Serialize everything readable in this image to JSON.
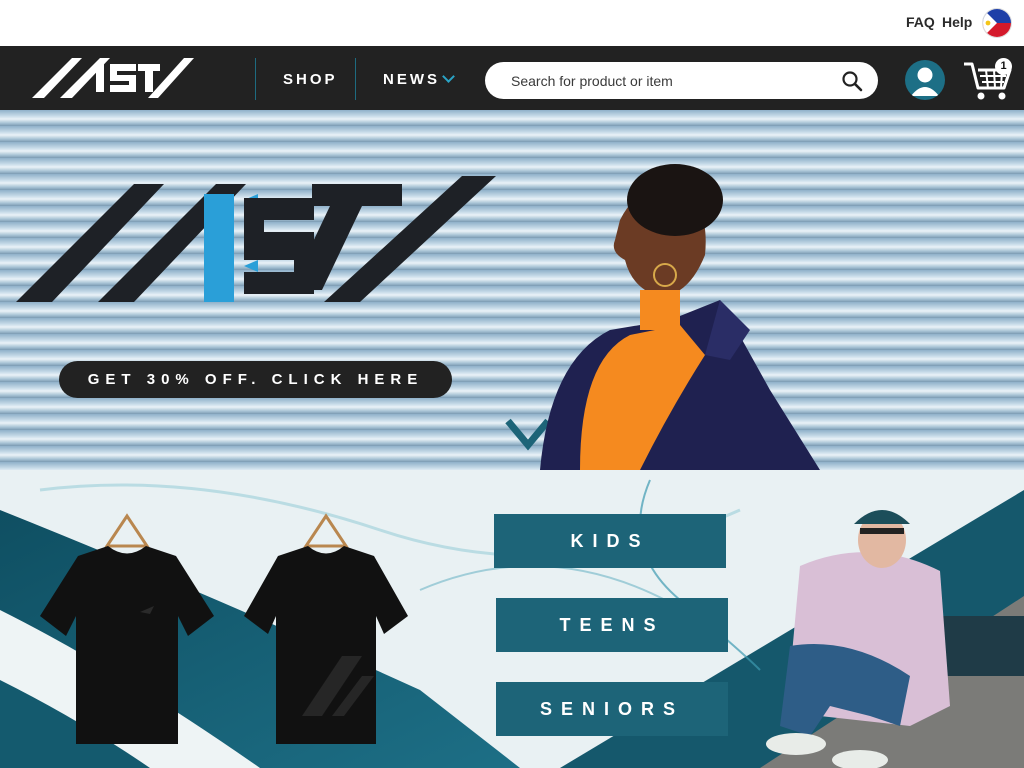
{
  "topbar": {
    "faq": "FAQ",
    "help": "Help",
    "flag_icon": "philippines-flag-icon"
  },
  "nav": {
    "logo_icon": "ast-logo-icon",
    "shop": "SHOP",
    "news": "NEWS",
    "search_placeholder": "Search for product or item",
    "search_icon": "search-icon",
    "account_icon": "user-icon",
    "cart_icon": "cart-icon",
    "cart_count": "1"
  },
  "hero": {
    "promo": "GET 30% OFF. CLICK HERE",
    "scroll_icon": "chevron-down-icon"
  },
  "categories": {
    "kids": "KIDS",
    "teens": "TEENS",
    "seniors": "SENIORS"
  },
  "colors": {
    "nav_bg": "#222222",
    "accent": "#1d6478",
    "accent_light": "#2aa4c6"
  }
}
